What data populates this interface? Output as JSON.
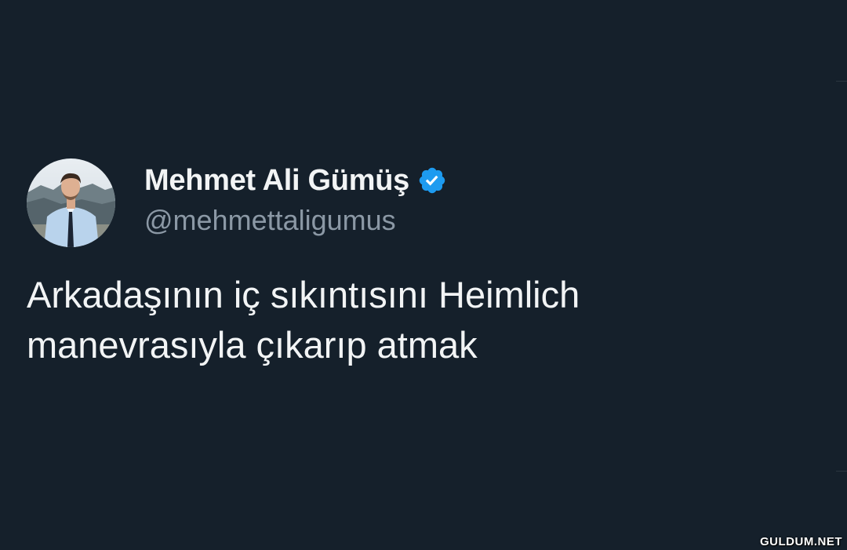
{
  "tweet": {
    "author": {
      "display_name": "Mehmet Ali Gümüş",
      "handle": "@mehmettaligumus",
      "verified": true,
      "avatar_icon": "profile-photo-man-in-suit"
    },
    "text": "Arkadaşının iç sıkıntısını Heimlich manevrasıyla çıkarıp atmak"
  },
  "watermark": {
    "text": "GULDUM.NET"
  },
  "colors": {
    "background": "#15202b",
    "text_primary": "#f2f4f5",
    "text_secondary": "#8b98a5",
    "verified_blue": "#1d9bf0"
  }
}
